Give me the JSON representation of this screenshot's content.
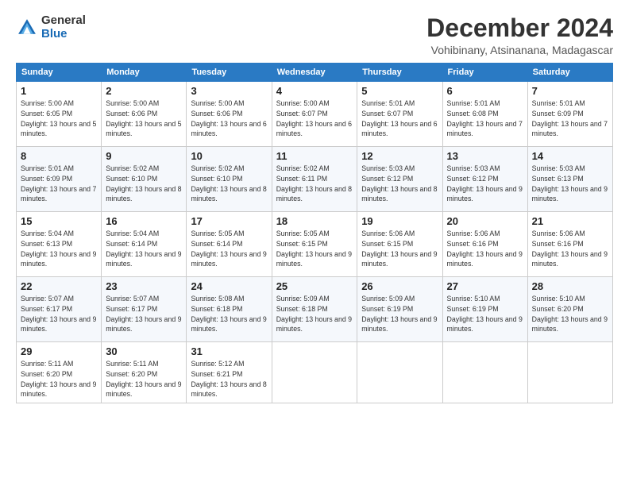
{
  "logo": {
    "general": "General",
    "blue": "Blue"
  },
  "title": "December 2024",
  "subtitle": "Vohibinany, Atsinanana, Madagascar",
  "headers": [
    "Sunday",
    "Monday",
    "Tuesday",
    "Wednesday",
    "Thursday",
    "Friday",
    "Saturday"
  ],
  "weeks": [
    [
      {
        "day": "1",
        "sunrise": "5:00 AM",
        "sunset": "6:05 PM",
        "daylight": "13 hours and 5 minutes."
      },
      {
        "day": "2",
        "sunrise": "5:00 AM",
        "sunset": "6:06 PM",
        "daylight": "13 hours and 5 minutes."
      },
      {
        "day": "3",
        "sunrise": "5:00 AM",
        "sunset": "6:06 PM",
        "daylight": "13 hours and 6 minutes."
      },
      {
        "day": "4",
        "sunrise": "5:00 AM",
        "sunset": "6:07 PM",
        "daylight": "13 hours and 6 minutes."
      },
      {
        "day": "5",
        "sunrise": "5:01 AM",
        "sunset": "6:07 PM",
        "daylight": "13 hours and 6 minutes."
      },
      {
        "day": "6",
        "sunrise": "5:01 AM",
        "sunset": "6:08 PM",
        "daylight": "13 hours and 7 minutes."
      },
      {
        "day": "7",
        "sunrise": "5:01 AM",
        "sunset": "6:09 PM",
        "daylight": "13 hours and 7 minutes."
      }
    ],
    [
      {
        "day": "8",
        "sunrise": "5:01 AM",
        "sunset": "6:09 PM",
        "daylight": "13 hours and 7 minutes."
      },
      {
        "day": "9",
        "sunrise": "5:02 AM",
        "sunset": "6:10 PM",
        "daylight": "13 hours and 8 minutes."
      },
      {
        "day": "10",
        "sunrise": "5:02 AM",
        "sunset": "6:10 PM",
        "daylight": "13 hours and 8 minutes."
      },
      {
        "day": "11",
        "sunrise": "5:02 AM",
        "sunset": "6:11 PM",
        "daylight": "13 hours and 8 minutes."
      },
      {
        "day": "12",
        "sunrise": "5:03 AM",
        "sunset": "6:12 PM",
        "daylight": "13 hours and 8 minutes."
      },
      {
        "day": "13",
        "sunrise": "5:03 AM",
        "sunset": "6:12 PM",
        "daylight": "13 hours and 9 minutes."
      },
      {
        "day": "14",
        "sunrise": "5:03 AM",
        "sunset": "6:13 PM",
        "daylight": "13 hours and 9 minutes."
      }
    ],
    [
      {
        "day": "15",
        "sunrise": "5:04 AM",
        "sunset": "6:13 PM",
        "daylight": "13 hours and 9 minutes."
      },
      {
        "day": "16",
        "sunrise": "5:04 AM",
        "sunset": "6:14 PM",
        "daylight": "13 hours and 9 minutes."
      },
      {
        "day": "17",
        "sunrise": "5:05 AM",
        "sunset": "6:14 PM",
        "daylight": "13 hours and 9 minutes."
      },
      {
        "day": "18",
        "sunrise": "5:05 AM",
        "sunset": "6:15 PM",
        "daylight": "13 hours and 9 minutes."
      },
      {
        "day": "19",
        "sunrise": "5:06 AM",
        "sunset": "6:15 PM",
        "daylight": "13 hours and 9 minutes."
      },
      {
        "day": "20",
        "sunrise": "5:06 AM",
        "sunset": "6:16 PM",
        "daylight": "13 hours and 9 minutes."
      },
      {
        "day": "21",
        "sunrise": "5:06 AM",
        "sunset": "6:16 PM",
        "daylight": "13 hours and 9 minutes."
      }
    ],
    [
      {
        "day": "22",
        "sunrise": "5:07 AM",
        "sunset": "6:17 PM",
        "daylight": "13 hours and 9 minutes."
      },
      {
        "day": "23",
        "sunrise": "5:07 AM",
        "sunset": "6:17 PM",
        "daylight": "13 hours and 9 minutes."
      },
      {
        "day": "24",
        "sunrise": "5:08 AM",
        "sunset": "6:18 PM",
        "daylight": "13 hours and 9 minutes."
      },
      {
        "day": "25",
        "sunrise": "5:09 AM",
        "sunset": "6:18 PM",
        "daylight": "13 hours and 9 minutes."
      },
      {
        "day": "26",
        "sunrise": "5:09 AM",
        "sunset": "6:19 PM",
        "daylight": "13 hours and 9 minutes."
      },
      {
        "day": "27",
        "sunrise": "5:10 AM",
        "sunset": "6:19 PM",
        "daylight": "13 hours and 9 minutes."
      },
      {
        "day": "28",
        "sunrise": "5:10 AM",
        "sunset": "6:20 PM",
        "daylight": "13 hours and 9 minutes."
      }
    ],
    [
      {
        "day": "29",
        "sunrise": "5:11 AM",
        "sunset": "6:20 PM",
        "daylight": "13 hours and 9 minutes."
      },
      {
        "day": "30",
        "sunrise": "5:11 AM",
        "sunset": "6:20 PM",
        "daylight": "13 hours and 9 minutes."
      },
      {
        "day": "31",
        "sunrise": "5:12 AM",
        "sunset": "6:21 PM",
        "daylight": "13 hours and 8 minutes."
      },
      null,
      null,
      null,
      null
    ]
  ],
  "labels": {
    "sunrise": "Sunrise:",
    "sunset": "Sunset:",
    "daylight": "Daylight:"
  }
}
